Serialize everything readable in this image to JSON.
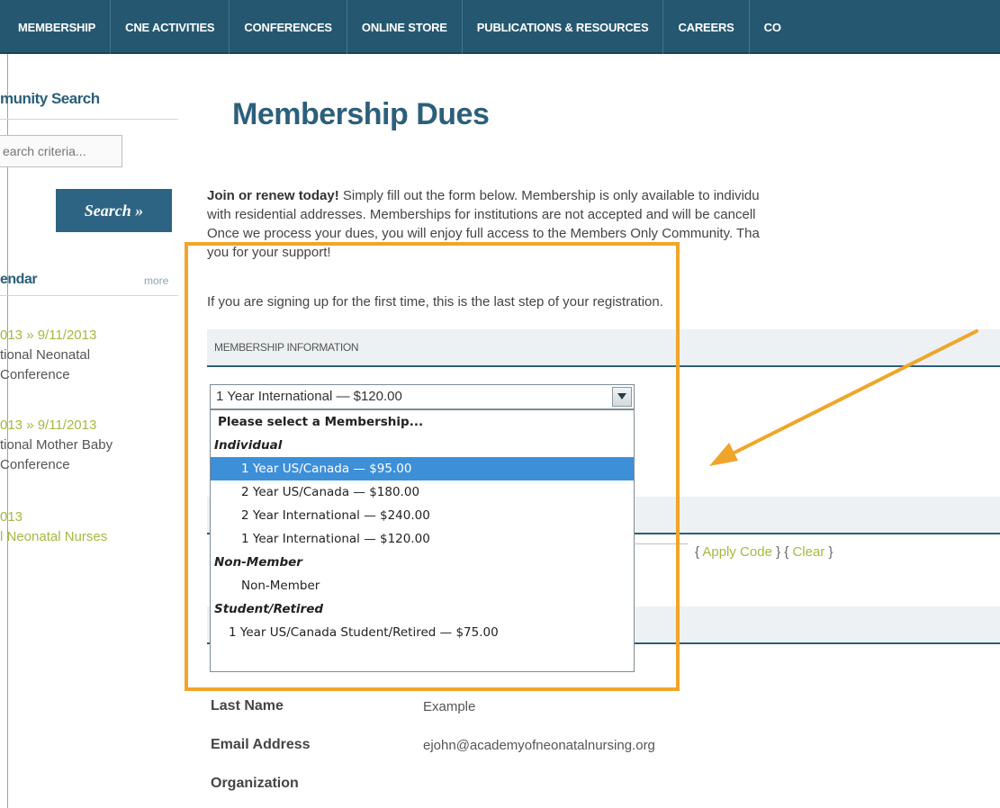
{
  "nav": {
    "items": [
      "MEMBERSHIP",
      "CNE ACTIVITIES",
      "CONFERENCES",
      "ONLINE STORE",
      "PUBLICATIONS & RESOURCES",
      "CAREERS",
      "CO"
    ]
  },
  "sidebar": {
    "search_heading": "munity Search",
    "search_placeholder": "earch criteria...",
    "search_button": "Search »",
    "calendar_title": "endar",
    "calendar_more": "more",
    "events": [
      {
        "date": "013 » 9/11/2013",
        "lines": [
          "tional Neonatal",
          "Conference"
        ]
      },
      {
        "date": "013 » 9/11/2013",
        "lines": [
          "tional Mother Baby",
          "Conference"
        ]
      },
      {
        "date": "013",
        "lines": [
          "l Neonatal Nurses"
        ]
      }
    ]
  },
  "main": {
    "title": "Membership Dues",
    "intro_bold": "Join or renew today!",
    "intro_line1": " Simply fill out the form below. Membership is only available to individu",
    "intro_line2": "with residential addresses. Memberships for institutions are not accepted and will be cancell",
    "intro_line3": "Once we process your dues, you will enjoy full access to the Members Only Community. Tha",
    "intro_line4": "you for your support!",
    "intro_p2": "If you are signing up for the first time, this is the last step of your registration.",
    "section_membership": "MEMBERSHIP INFORMATION",
    "select_value": "1 Year International — $120.00",
    "dropdown": {
      "placeholder": "Please select a Membership...",
      "group_individual": "Individual",
      "opt_1": "1 Year US/Canada — $95.00",
      "opt_2": "2 Year US/Canada — $180.00",
      "opt_3": "2 Year International — $240.00",
      "opt_4": "1 Year International — $120.00",
      "group_nonmember": "Non-Member",
      "opt_nonmember": "Non-Member",
      "group_student": "Student/Retired",
      "opt_student": "1 Year US/Canada Student/Retired — $75.00"
    },
    "apply_open": "{ ",
    "apply_code": "Apply Code",
    "apply_mid": " } { ",
    "clear": "Clear",
    "apply_close": " }",
    "form": {
      "last_name_label": "Last Name",
      "last_name_value": "Example",
      "email_label": "Email Address",
      "email_value": "ejohn@academyofneonatalnursing.org",
      "org_label": "Organization"
    }
  },
  "colors": {
    "nav_bg": "#255870",
    "accent": "#2c5f7a",
    "highlight": "#f0a52a",
    "selected": "#3d8fd8",
    "link_green": "#a3b93f"
  }
}
